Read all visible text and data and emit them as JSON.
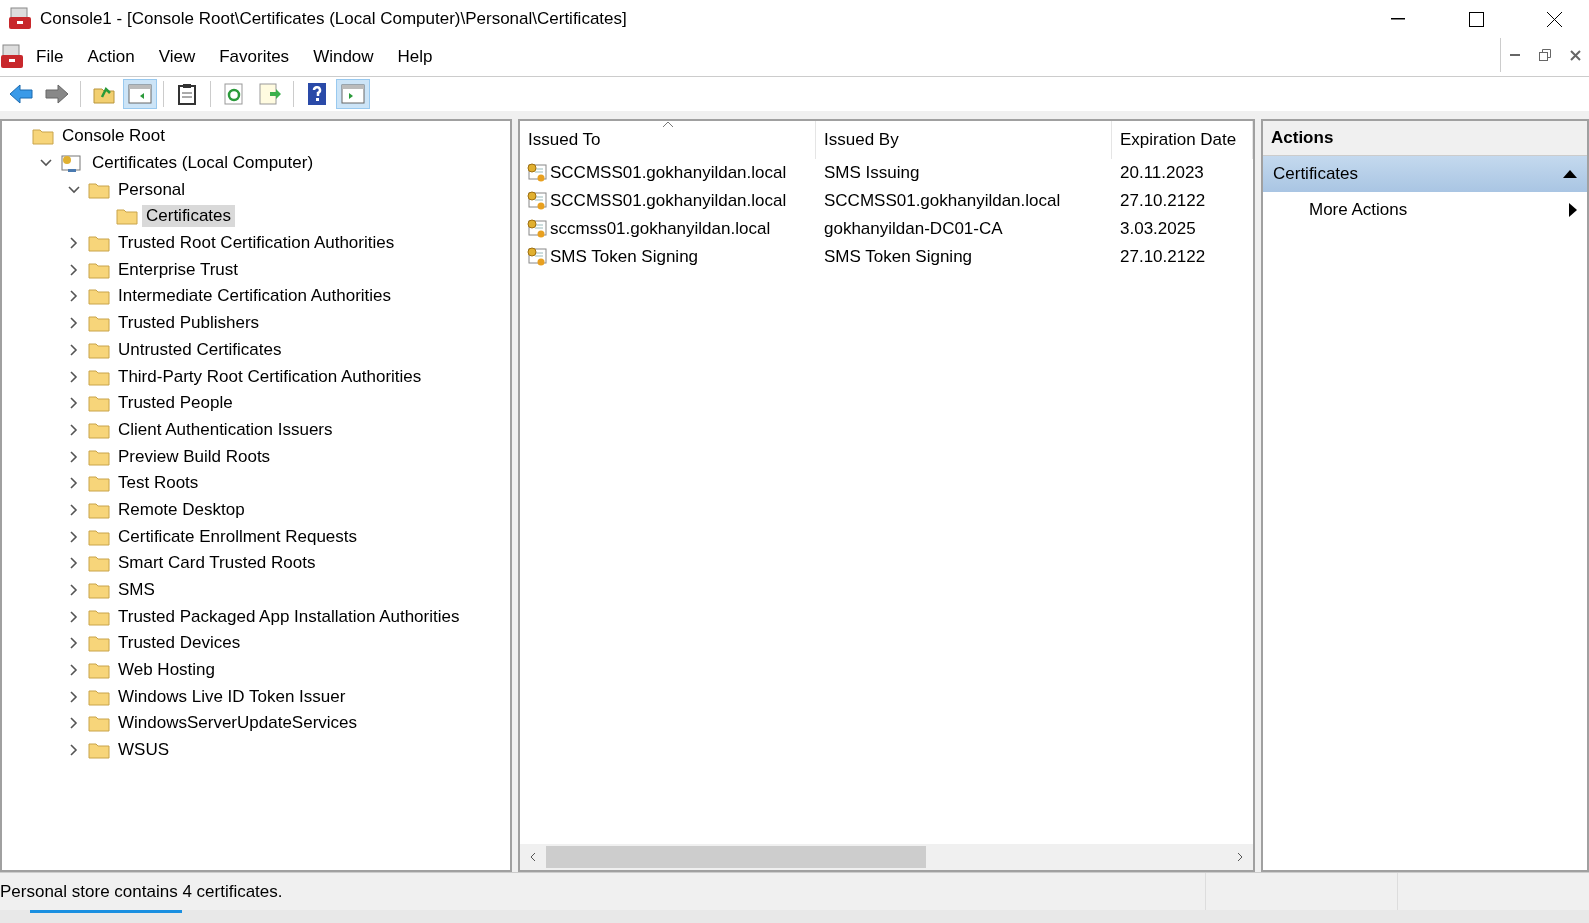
{
  "window": {
    "title": "Console1 - [Console Root\\Certificates (Local Computer)\\Personal\\Certificates]"
  },
  "menu": [
    "File",
    "Action",
    "View",
    "Favorites",
    "Window",
    "Help"
  ],
  "toolbar": [
    {
      "kind": "back",
      "pressed": false
    },
    {
      "kind": "forward",
      "pressed": false
    },
    {
      "kind": "sep"
    },
    {
      "kind": "up",
      "pressed": false
    },
    {
      "kind": "tree",
      "pressed": true
    },
    {
      "kind": "sep"
    },
    {
      "kind": "clipboard",
      "pressed": false
    },
    {
      "kind": "sep"
    },
    {
      "kind": "refresh",
      "pressed": false
    },
    {
      "kind": "export",
      "pressed": false
    },
    {
      "kind": "sep"
    },
    {
      "kind": "help",
      "pressed": false
    },
    {
      "kind": "actionpane",
      "pressed": true
    }
  ],
  "tree": [
    {
      "label": "Console Root",
      "kind": "root",
      "selected": false,
      "children": [
        {
          "label": "Certificates (Local Computer)",
          "kind": "store",
          "expanded": true,
          "selected": false,
          "children": [
            {
              "label": "Personal",
              "kind": "folder",
              "expanded": true,
              "selected": false,
              "children": [
                {
                  "label": "Certificates",
                  "kind": "folder",
                  "selected": true
                }
              ]
            },
            {
              "label": "Trusted Root Certification Authorities",
              "kind": "folder",
              "expanded": false,
              "selected": false
            },
            {
              "label": "Enterprise Trust",
              "kind": "folder",
              "expanded": false,
              "selected": false
            },
            {
              "label": "Intermediate Certification Authorities",
              "kind": "folder",
              "expanded": false,
              "selected": false
            },
            {
              "label": "Trusted Publishers",
              "kind": "folder",
              "expanded": false,
              "selected": false
            },
            {
              "label": "Untrusted Certificates",
              "kind": "folder",
              "expanded": false,
              "selected": false
            },
            {
              "label": "Third-Party Root Certification Authorities",
              "kind": "folder",
              "expanded": false,
              "selected": false
            },
            {
              "label": "Trusted People",
              "kind": "folder",
              "expanded": false,
              "selected": false
            },
            {
              "label": "Client Authentication Issuers",
              "kind": "folder",
              "expanded": false,
              "selected": false
            },
            {
              "label": "Preview Build Roots",
              "kind": "folder",
              "expanded": false,
              "selected": false
            },
            {
              "label": "Test Roots",
              "kind": "folder",
              "expanded": false,
              "selected": false
            },
            {
              "label": "Remote Desktop",
              "kind": "folder",
              "expanded": false,
              "selected": false
            },
            {
              "label": "Certificate Enrollment Requests",
              "kind": "folder",
              "expanded": false,
              "selected": false
            },
            {
              "label": "Smart Card Trusted Roots",
              "kind": "folder",
              "expanded": false,
              "selected": false
            },
            {
              "label": "SMS",
              "kind": "folder",
              "expanded": false,
              "selected": false
            },
            {
              "label": "Trusted Packaged App Installation Authorities",
              "kind": "folder",
              "expanded": false,
              "selected": false
            },
            {
              "label": "Trusted Devices",
              "kind": "folder",
              "expanded": false,
              "selected": false
            },
            {
              "label": "Web Hosting",
              "kind": "folder",
              "expanded": false,
              "selected": false
            },
            {
              "label": "Windows Live ID Token Issuer",
              "kind": "folder",
              "expanded": false,
              "selected": false
            },
            {
              "label": "WindowsServerUpdateServices",
              "kind": "folder",
              "expanded": false,
              "selected": false
            },
            {
              "label": "WSUS",
              "kind": "folder",
              "expanded": false,
              "selected": false
            }
          ]
        }
      ]
    }
  ],
  "table": {
    "columns": [
      "Issued To",
      "Issued By",
      "Expiration Date"
    ],
    "rows": [
      [
        "SCCMSS01.gokhanyildan.local",
        "SMS Issuing",
        "20.11.2023"
      ],
      [
        "SCCMSS01.gokhanyildan.local",
        "SCCMSS01.gokhanyildan.local",
        "27.10.2122"
      ],
      [
        "sccmss01.gokhanyildan.local",
        "gokhanyildan-DC01-CA",
        "3.03.2025"
      ],
      [
        "SMS Token Signing",
        "SMS Token Signing",
        "27.10.2122"
      ]
    ]
  },
  "actions": {
    "title": "Actions",
    "section": {
      "label": "Certificates",
      "expanded": true
    },
    "items": [
      "More Actions"
    ]
  },
  "status_bar": "Personal store contains 4 certificates."
}
